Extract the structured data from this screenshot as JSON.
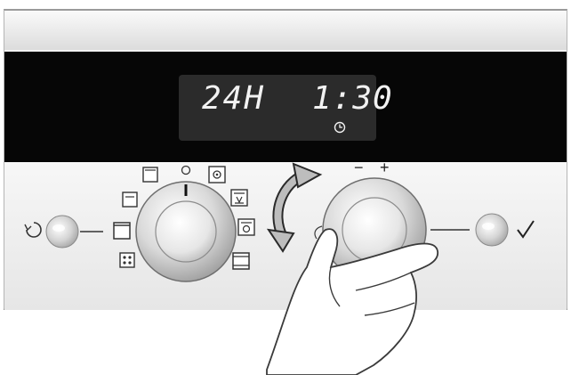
{
  "display": {
    "timer_hours": "24H",
    "clock_time": "1:30",
    "clock_symbol": "clock-icon"
  },
  "knob_right": {
    "minus_label": "−",
    "plus_label": "+"
  },
  "buttons": {
    "left_symbol": "power-cycle-icon",
    "right_symbol": "checkmark-icon"
  },
  "mode_icons": [
    "off-icon",
    "top-heat-icon",
    "fan-icon",
    "grill-icon",
    "fan-grill-icon",
    "conventional-icon",
    "bottom-heat-icon",
    "defrost-icon",
    "top-bottom-icon"
  ],
  "colors": {
    "display_background": "#060606",
    "lcd_panel": "#2b2b2b",
    "digits": "#f2f2f2",
    "panel": "#eeeeee"
  }
}
